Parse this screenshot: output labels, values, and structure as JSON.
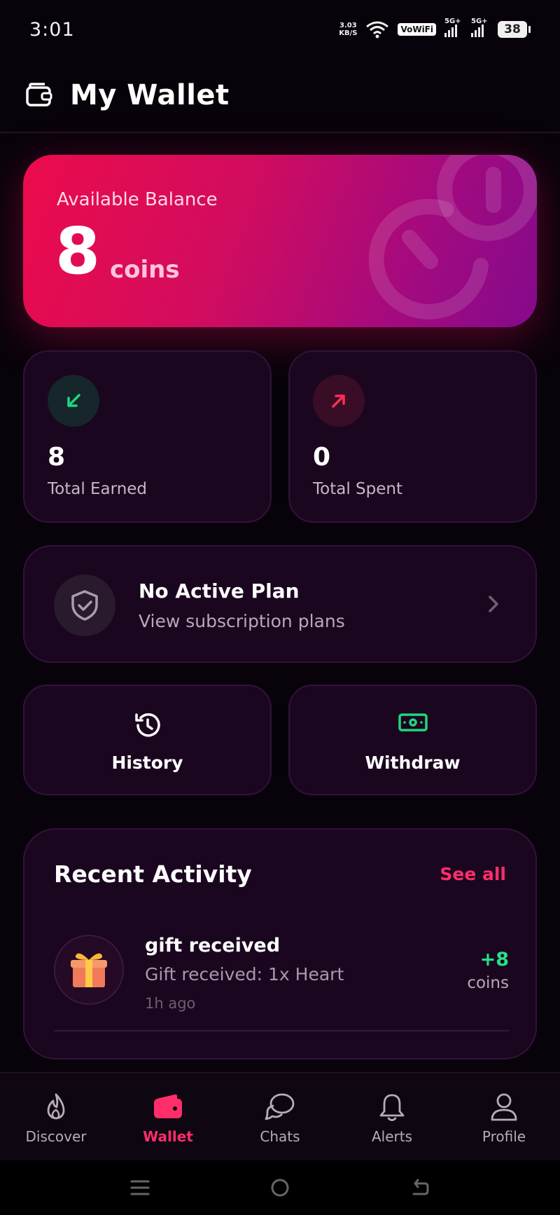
{
  "status_bar": {
    "time": "3:01",
    "net_speed_value": "3.03",
    "net_speed_unit": "KB/S",
    "vowifi": "VoWiFi",
    "sim1_label": "5G+",
    "sim2_label": "5G+",
    "battery": "38"
  },
  "header": {
    "title": "My Wallet",
    "icon": "wallet-icon"
  },
  "balance": {
    "label": "Available Balance",
    "value": "8",
    "unit": "coins"
  },
  "stats": {
    "earned": {
      "value": "8",
      "label": "Total Earned",
      "icon": "arrow-down-left-icon",
      "color": "#1fd67f"
    },
    "spent": {
      "value": "0",
      "label": "Total Spent",
      "icon": "arrow-up-right-icon",
      "color": "#ff2d55"
    }
  },
  "plan": {
    "title": "No Active Plan",
    "subtitle": "View subscription plans",
    "icon": "shield-check-icon"
  },
  "actions": {
    "history": {
      "label": "History",
      "icon": "history-icon"
    },
    "withdraw": {
      "label": "Withdraw",
      "icon": "cash-icon",
      "color": "#1fd67f"
    }
  },
  "activity": {
    "title": "Recent Activity",
    "see_all": "See all",
    "items": [
      {
        "title": "gift received",
        "description": "Gift received: 1x Heart",
        "time": "1h ago",
        "amount": "+8",
        "unit": "coins",
        "icon": "gift-icon"
      }
    ]
  },
  "bottom_nav": {
    "items": [
      {
        "label": "Discover",
        "icon": "flame-icon",
        "active": false
      },
      {
        "label": "Wallet",
        "icon": "wallet-icon",
        "active": true
      },
      {
        "label": "Chats",
        "icon": "chat-bubbles-icon",
        "active": false
      },
      {
        "label": "Alerts",
        "icon": "bell-icon",
        "active": false
      },
      {
        "label": "Profile",
        "icon": "user-icon",
        "active": false
      }
    ]
  },
  "colors": {
    "accent": "#ff2d6a",
    "background": "#08030b",
    "card": "#1b0620",
    "success": "#27e08a"
  }
}
